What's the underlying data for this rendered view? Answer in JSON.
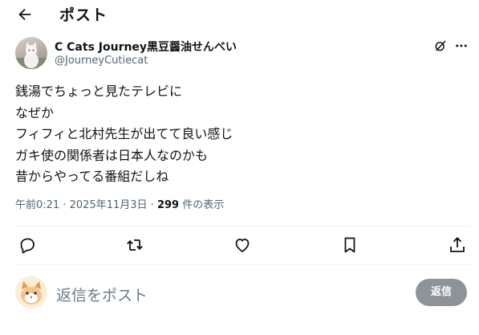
{
  "header": {
    "title": "ポスト",
    "back_icon": "arrow-left-icon"
  },
  "author": {
    "display_name": "C Cats Journey黒豆醤油せんべい",
    "handle": "@JourneyCutiecat"
  },
  "post": {
    "lines": [
      "銭湯でちょっと見たテレビに",
      "なぜか",
      "フィフィと北村先生が出てて良い感じ",
      "ガキ使の関係者は日本人なのかも",
      "昔からやってる番組だしね"
    ],
    "time": "午前0:21",
    "date": "2025年11月3日",
    "separator": "·",
    "views_count": "299",
    "views_label": "件の表示"
  },
  "actions": [
    "reply-icon",
    "repost-icon",
    "like-icon",
    "bookmark-icon",
    "share-icon"
  ],
  "composer": {
    "placeholder": "返信をポスト",
    "button_label": "返信"
  },
  "colors": {
    "text": "#0f1419",
    "secondary": "#536471",
    "divider": "#eff3f4",
    "button_disabled": "#8d9499"
  }
}
